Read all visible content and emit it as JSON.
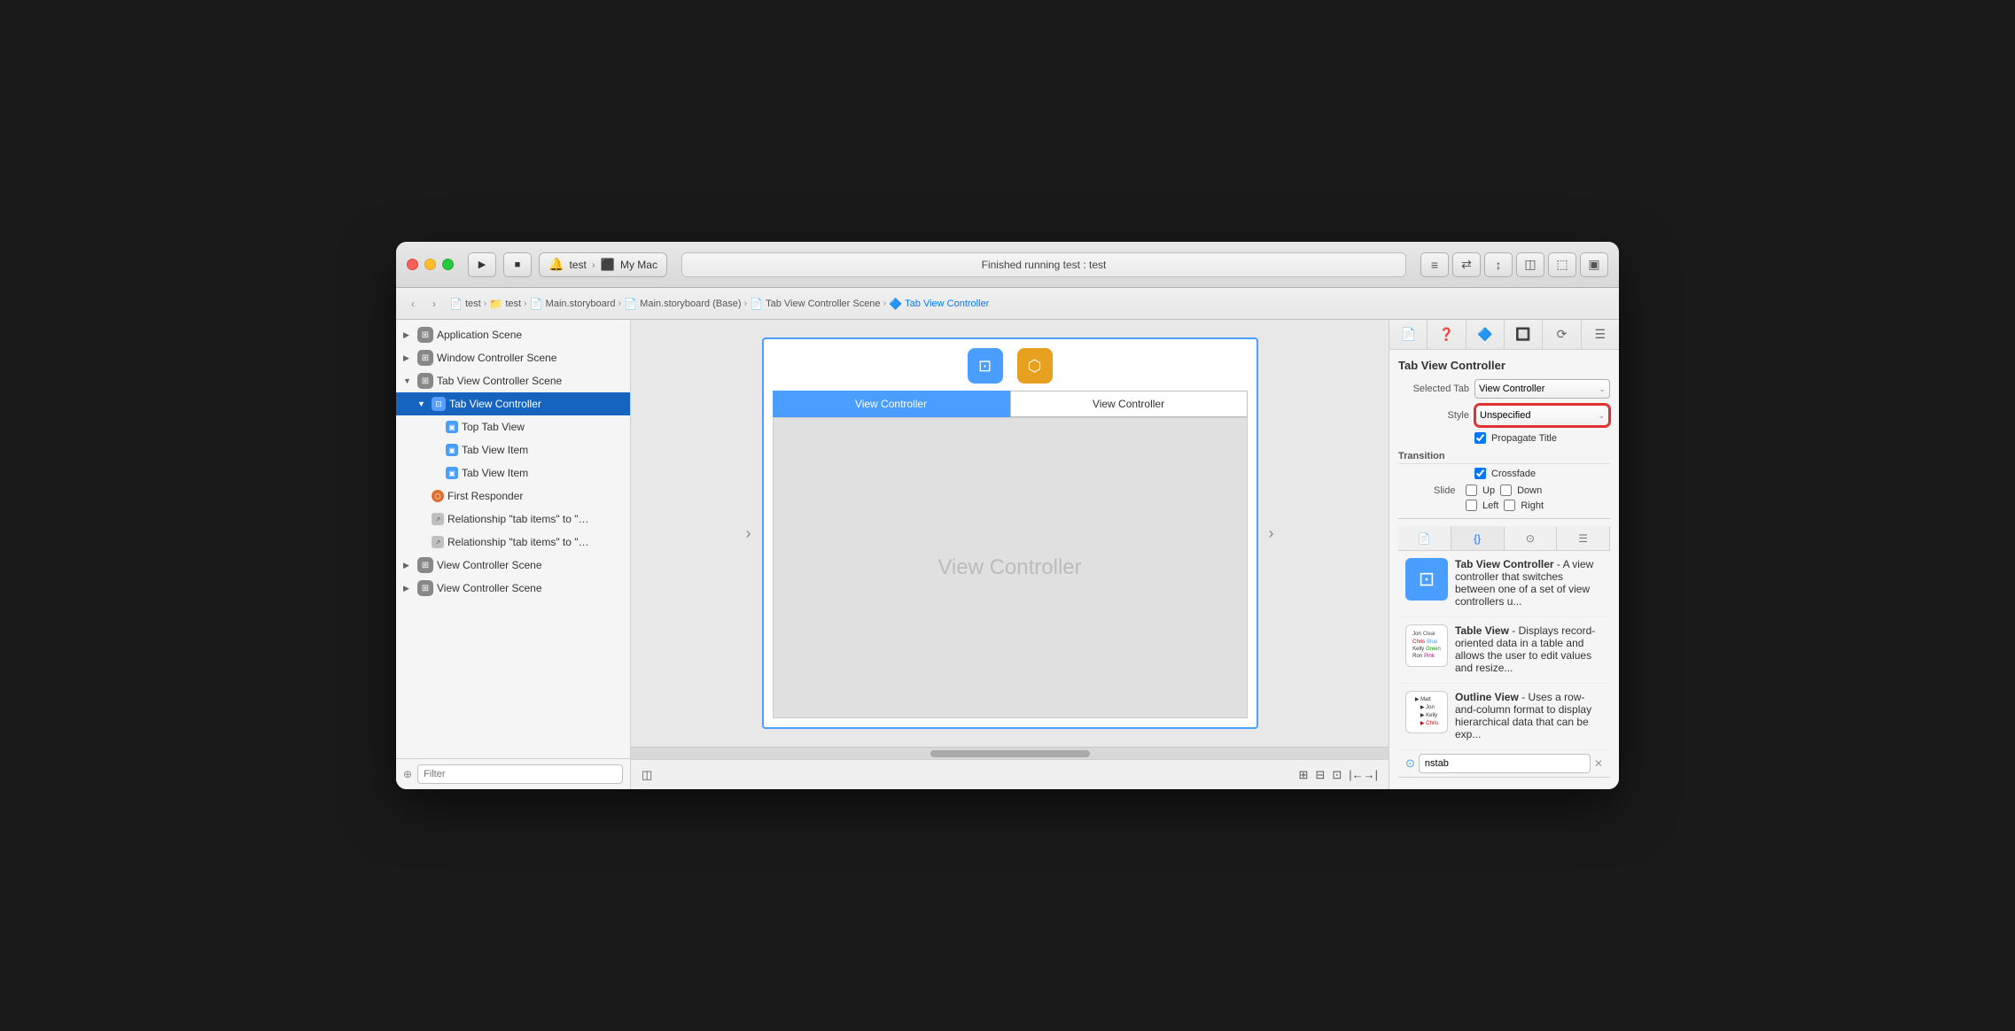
{
  "window": {
    "title": "test — My Mac"
  },
  "titlebar": {
    "scheme_name": "test",
    "scheme_device": "My Mac",
    "status_text": "Finished running test : test",
    "play_label": "▶",
    "stop_label": "■"
  },
  "breadcrumb": {
    "items": [
      {
        "label": "test",
        "icon": "📄"
      },
      {
        "label": "test",
        "icon": "📁"
      },
      {
        "label": "Main.storyboard",
        "icon": "📄"
      },
      {
        "label": "Main.storyboard (Base)",
        "icon": "📄"
      },
      {
        "label": "Tab View Controller Scene",
        "icon": "📄"
      },
      {
        "label": "Tab View Controller",
        "icon": "🔷"
      }
    ]
  },
  "sidebar": {
    "items": [
      {
        "id": "app-scene",
        "label": "Application Scene",
        "indent": 0,
        "expanded": false,
        "type": "scene"
      },
      {
        "id": "window-ctrl-scene",
        "label": "Window Controller Scene",
        "indent": 0,
        "expanded": false,
        "type": "scene"
      },
      {
        "id": "tab-view-ctrl-scene",
        "label": "Tab View Controller Scene",
        "indent": 0,
        "expanded": true,
        "type": "scene"
      },
      {
        "id": "tab-view-ctrl",
        "label": "Tab View Controller",
        "indent": 1,
        "expanded": true,
        "type": "tabviewctrl",
        "selected": true
      },
      {
        "id": "top-tab-view",
        "label": "Top Tab View",
        "indent": 2,
        "expanded": false,
        "type": "view"
      },
      {
        "id": "tab-view-item-1",
        "label": "Tab View Item",
        "indent": 2,
        "expanded": false,
        "type": "view"
      },
      {
        "id": "tab-view-item-2",
        "label": "Tab View Item",
        "indent": 2,
        "expanded": false,
        "type": "view"
      },
      {
        "id": "first-responder",
        "label": "First Responder",
        "indent": 1,
        "expanded": false,
        "type": "responder"
      },
      {
        "id": "relationship-1",
        "label": "Relationship \"tab items\" to \"View...",
        "indent": 1,
        "expanded": false,
        "type": "rel"
      },
      {
        "id": "relationship-2",
        "label": "Relationship \"tab items\" to \"View...",
        "indent": 1,
        "expanded": false,
        "type": "rel"
      },
      {
        "id": "view-ctrl-scene-1",
        "label": "View Controller Scene",
        "indent": 0,
        "expanded": false,
        "type": "scene"
      },
      {
        "id": "view-ctrl-scene-2",
        "label": "View Controller Scene",
        "indent": 0,
        "expanded": false,
        "type": "scene"
      }
    ],
    "filter_placeholder": "Filter"
  },
  "canvas": {
    "tab1_label": "View Controller",
    "tab2_label": "View Controller",
    "scene_label": "View Controller",
    "tab1_active": true
  },
  "inspector": {
    "title": "Tab View Controller",
    "selected_tab_label": "Selected Tab",
    "selected_tab_value": "View Controller",
    "style_label": "Style",
    "style_value": "Unspecified",
    "style_highlighted": true,
    "propagate_title_label": "Propagate Title",
    "propagate_title_checked": true,
    "transition_label": "Transition",
    "crossfade_label": "Crossfade",
    "crossfade_checked": true,
    "slide_label": "Slide",
    "up_label": "Up",
    "down_label": "Down",
    "left_label": "Left",
    "right_label": "Right"
  },
  "library": {
    "search_placeholder": "nstab",
    "items": [
      {
        "id": "tab-view-controller",
        "title": "Tab View Controller",
        "desc": "A view controller that switches between one of a set of view controllers u...",
        "icon_type": "tvc"
      },
      {
        "id": "table-view",
        "title": "Table View",
        "desc": "Displays record-oriented data in a table and allows the user to edit values and resize...",
        "icon_type": "table"
      },
      {
        "id": "outline-view",
        "title": "Outline View",
        "desc": "Uses a row-and-column format to display hierarchical data that can be exp...",
        "icon_type": "outline"
      }
    ],
    "table_preview_rows": [
      {
        "cols": [
          "Jon",
          "Clear",
          ""
        ],
        "colors": [
          "",
          "blue",
          ""
        ]
      },
      {
        "cols": [
          "Chris",
          "Blue",
          ""
        ],
        "colors": [
          "",
          "blue",
          ""
        ]
      },
      {
        "cols": [
          "Kelly",
          "Green",
          ""
        ],
        "colors": [
          "",
          "green",
          ""
        ]
      },
      {
        "cols": [
          "Ron",
          "Pink",
          ""
        ],
        "colors": [
          "",
          "pink",
          ""
        ]
      }
    ],
    "outline_rows": [
      {
        "indent": 0,
        "label": "Matt"
      },
      {
        "indent": 1,
        "label": "Jon"
      },
      {
        "indent": 1,
        "label": "Kelly"
      },
      {
        "indent": 1,
        "label": "Chris"
      }
    ]
  },
  "inspector_tabs": [
    "📄",
    "❓",
    "🔷",
    "🔲",
    "⟳",
    "☰"
  ],
  "library_tabs": [
    "📄",
    "{}",
    "⊙",
    "☰"
  ]
}
